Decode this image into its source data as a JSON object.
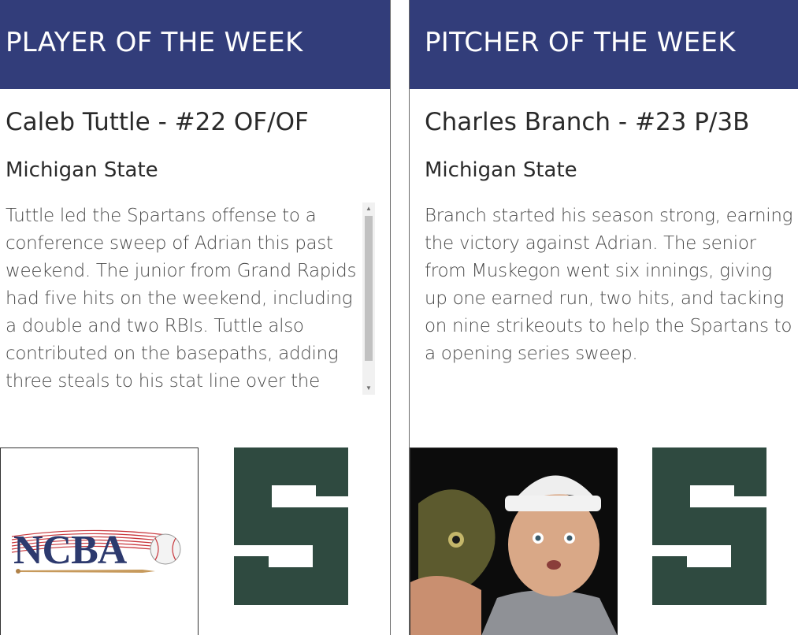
{
  "left_card": {
    "header": "PLAYER OF THE WEEK",
    "name": "Caleb Tuttle - #22 OF/OF",
    "school": "Michigan State",
    "blurb": "Tuttle led the Spartans offense to a conference sweep of Adrian this past weekend. The junior from Grand Rapids had five hits on the weekend, including a double and two RBIs. Tuttle also contributed on the basepaths, adding three steals to his stat line over the",
    "logo_text": "NCBA",
    "icons": [
      "ncba-logo",
      "spartan-s-icon"
    ]
  },
  "right_card": {
    "header": "PITCHER OF THE WEEK",
    "name": "Charles Branch - #23 P/3B",
    "school": "Michigan State",
    "blurb": "Branch started his season strong, earning the victory against Adrian. The senior from Muskegon went six innings, giving up one earned run, two hits, and tacking on nine strikeouts to help the Spartans to a opening series sweep.",
    "icons": [
      "player-photo",
      "spartan-s-icon"
    ]
  },
  "colors": {
    "header_bg": "#323d7a",
    "spartan_green": "#2f4a40",
    "text_dark": "#2a2a2a",
    "text_body": "#4a4a4a"
  }
}
